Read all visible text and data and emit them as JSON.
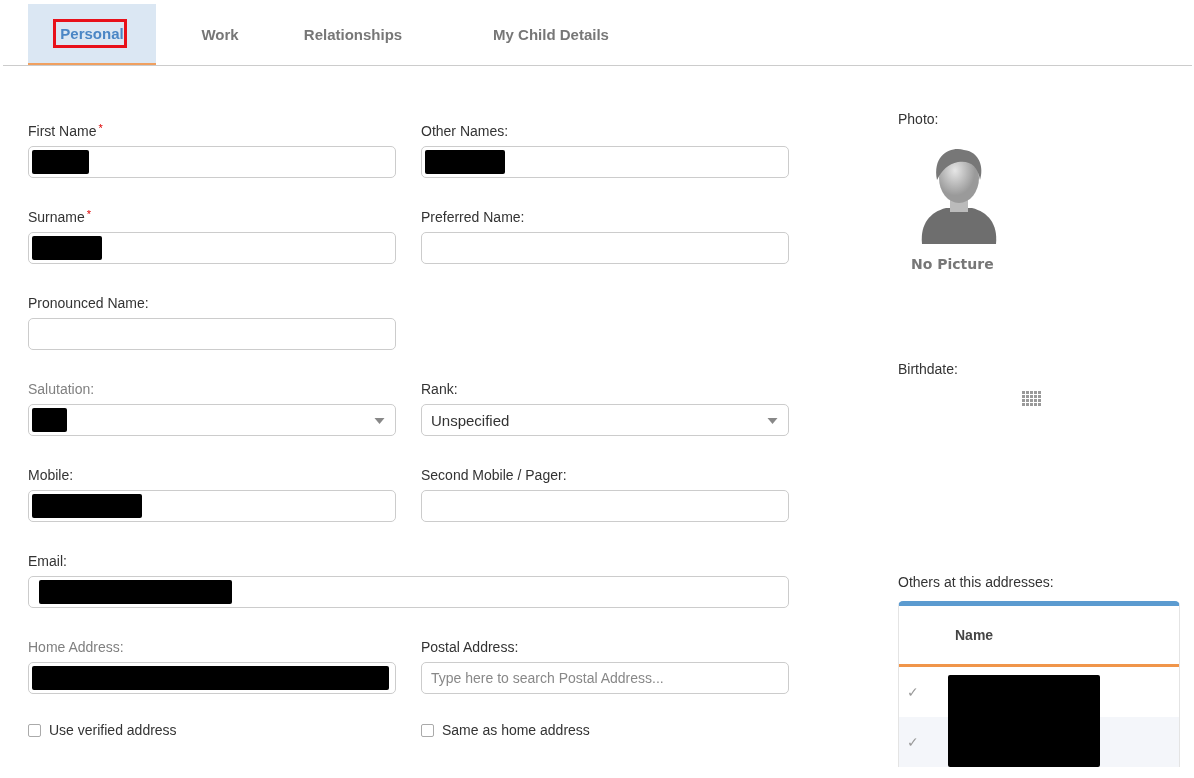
{
  "tabs": [
    {
      "label": "Personal",
      "selected": true,
      "highlighted": true
    },
    {
      "label": "Work",
      "selected": false,
      "highlighted": false
    },
    {
      "label": "Relationships",
      "selected": false,
      "highlighted": false
    },
    {
      "label": "My Child Details",
      "selected": false,
      "highlighted": false
    }
  ],
  "form": {
    "rows": [
      [
        {
          "label": "First Name",
          "kind": "text",
          "required_mark": "*",
          "dimmed": false,
          "redacted": true
        },
        {
          "label": "Other Names:",
          "kind": "text",
          "dimmed": false,
          "redacted": true
        }
      ],
      [
        {
          "label": "Surname",
          "kind": "text",
          "required_mark": "*",
          "dimmed": false,
          "redacted": true
        },
        {
          "label": "Preferred Name:",
          "kind": "text",
          "dimmed": false,
          "redacted": false
        }
      ],
      [
        {
          "label": "Pronounced Name:",
          "kind": "text",
          "dimmed": false,
          "redacted": false
        }
      ],
      [
        {
          "label": "Salutation:",
          "kind": "select",
          "dimmed": true,
          "redacted": true
        },
        {
          "label": "Rank:",
          "kind": "select",
          "dimmed": false,
          "redacted": false,
          "value": "Unspecified"
        }
      ],
      [
        {
          "label": "Mobile:",
          "kind": "text",
          "dimmed": false,
          "redacted": true
        },
        {
          "label": "Second Mobile / Pager:",
          "kind": "text",
          "dimmed": false,
          "redacted": false
        }
      ],
      [
        {
          "label": "Email:",
          "kind": "wide",
          "dimmed": false,
          "redacted": true
        }
      ],
      [
        {
          "label": "Home Address:",
          "kind": "text",
          "dimmed": true,
          "redacted": true
        },
        {
          "label": "Postal Address:",
          "kind": "text",
          "dimmed": false,
          "redacted": false,
          "placeholder": "Type here to search Postal Address..."
        }
      ]
    ],
    "checkboxes": [
      {
        "label": "Use verified address",
        "checked": false
      },
      {
        "label": "Same as home address",
        "checked": false
      }
    ]
  },
  "photo": {
    "label": "Photo:",
    "caption": "No Picture"
  },
  "birthdate": {
    "label": "Birthdate:"
  },
  "others": {
    "label": "Others at this addresses:",
    "column": "Name",
    "rows": [
      {
        "mark": "✓",
        "redacted": true
      },
      {
        "mark": "✓",
        "redacted": true
      }
    ]
  }
}
